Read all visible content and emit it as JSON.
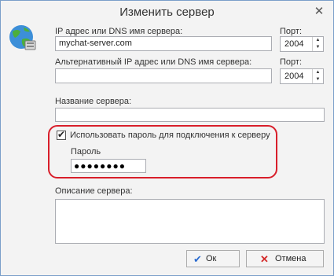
{
  "window": {
    "title": "Изменить сервер",
    "close": "✕"
  },
  "fields": {
    "ip_label": "IP адрес или DNS имя сервера:",
    "ip_value": "mychat-server.com",
    "port_label": "Порт:",
    "port_value": "2004",
    "alt_ip_label": "Альтернативный IP адрес или DNS имя сервера:",
    "alt_ip_value": "",
    "alt_port_label": "Порт:",
    "alt_port_value": "2004",
    "name_label": "Название сервера:",
    "name_value": "",
    "use_password_label": "Использовать пароль для подключения к серверу",
    "use_password_checked": true,
    "password_label": "Пароль",
    "password_value": "●●●●●●●●",
    "description_label": "Описание сервера:",
    "description_value": ""
  },
  "buttons": {
    "ok": "Ок",
    "cancel": "Отмена"
  },
  "colors": {
    "highlight": "#d81e2a",
    "ok_icon": "#2a6bd0",
    "cancel_icon": "#d42a2a"
  }
}
